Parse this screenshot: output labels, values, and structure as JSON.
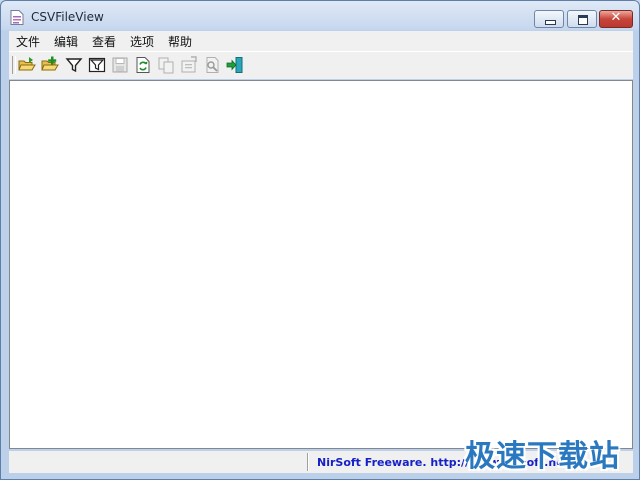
{
  "window": {
    "title": "CSVFileView",
    "app_icon": "csv-file-icon"
  },
  "controls": {
    "minimize": "minimize-icon",
    "maximize": "maximize-icon",
    "close_glyph": "✕"
  },
  "menu": {
    "items": [
      {
        "label": "文件"
      },
      {
        "label": "编辑"
      },
      {
        "label": "查看"
      },
      {
        "label": "选项"
      },
      {
        "label": "帮助"
      }
    ]
  },
  "toolbar": {
    "buttons": [
      {
        "icon": "open-folder-icon",
        "enabled": true
      },
      {
        "icon": "open-folder-plus-icon",
        "enabled": true
      },
      {
        "icon": "filter-icon",
        "enabled": true
      },
      {
        "icon": "filter-clear-icon",
        "enabled": true
      },
      {
        "icon": "save-icon",
        "enabled": false
      },
      {
        "icon": "refresh-icon",
        "enabled": true
      },
      {
        "icon": "copy-icon",
        "enabled": false
      },
      {
        "icon": "properties-icon",
        "enabled": false
      },
      {
        "icon": "find-icon",
        "enabled": false
      },
      {
        "icon": "exit-icon",
        "enabled": true
      }
    ]
  },
  "status": {
    "link_text": "NirSoft Freeware.  http://www.nirsoft.net"
  },
  "watermark": {
    "text": "极速下载站"
  }
}
